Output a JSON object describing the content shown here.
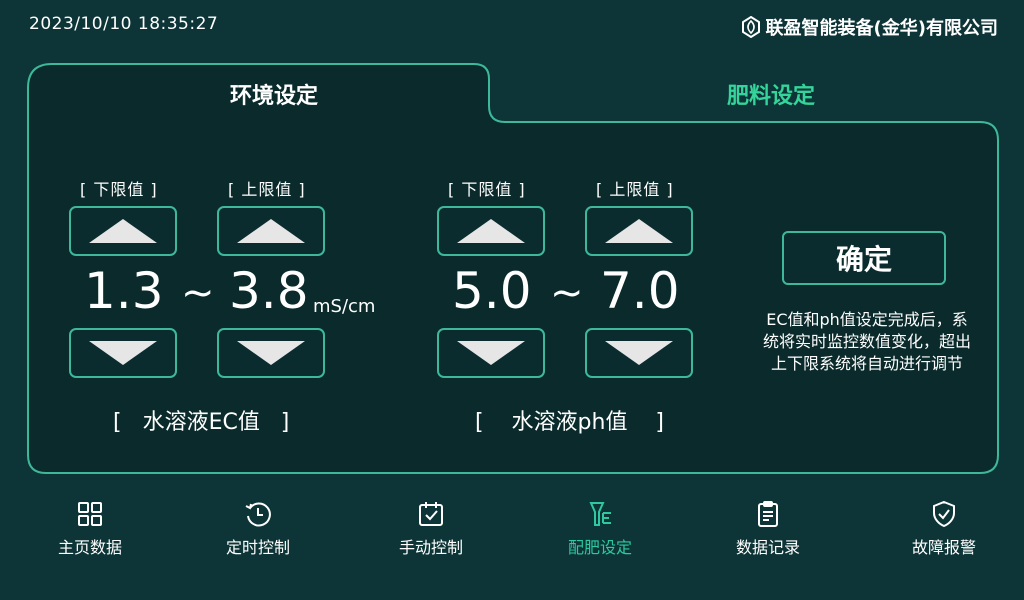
{
  "header": {
    "datetime": "2023/10/10  18:35:27",
    "brand": "联盈智能装备(金华)有限公司",
    "logo_icon": "hexagon-leaf-icon"
  },
  "tabs": [
    {
      "label": "环境设定",
      "active": true
    },
    {
      "label": "肥料设定",
      "active": false
    }
  ],
  "ec": {
    "lower_label": "[  下限值  ]",
    "upper_label": "[  上限值  ]",
    "lower_value": "1.3",
    "separator": "~",
    "upper_value": "3.8",
    "unit": "mS/cm",
    "group_label": "[   水溶液EC值   ]"
  },
  "ph": {
    "lower_label": "[  下限值  ]",
    "upper_label": "[  上限值  ]",
    "lower_value": "5.0",
    "separator": "~",
    "upper_value": "7.0",
    "group_label": "[    水溶液ph值    ]"
  },
  "confirm": {
    "label": "确定",
    "note": "EC值和ph值设定完成后，系统将实时监控数值变化，超出上下限系统将自动进行调节"
  },
  "nav": [
    {
      "label": "主页数据",
      "icon": "grid-icon"
    },
    {
      "label": "定时控制",
      "icon": "clock-icon"
    },
    {
      "label": "手动控制",
      "icon": "calendar-check-icon"
    },
    {
      "label": "配肥设定",
      "icon": "fertilizer-icon",
      "active": true
    },
    {
      "label": "数据记录",
      "icon": "clipboard-icon"
    },
    {
      "label": "故障报警",
      "icon": "shield-check-icon"
    }
  ],
  "colors": {
    "background": "#0d3537",
    "panel": "#0a2a2b",
    "accent": "#3fb89a",
    "active_text": "#2ec9a0"
  }
}
